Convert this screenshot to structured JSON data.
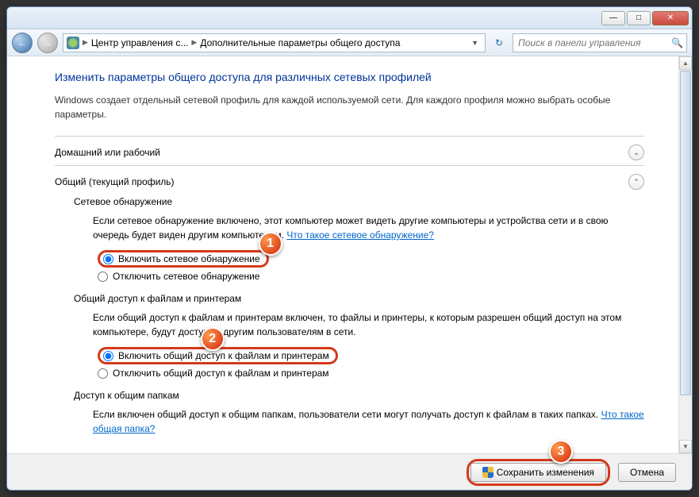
{
  "titlebar": {},
  "navbar": {
    "breadcrumb": {
      "item1": "Центр управления с...",
      "item2": "Дополнительные параметры общего доступа"
    },
    "search_placeholder": "Поиск в панели управления"
  },
  "heading": "Изменить параметры общего доступа для различных сетевых профилей",
  "intro": "Windows создает отдельный сетевой профиль для каждой используемой сети. Для каждого профиля можно выбрать особые параметры.",
  "profiles": {
    "home": {
      "title": "Домашний или рабочий"
    },
    "public": {
      "title": "Общий (текущий профиль)"
    }
  },
  "discovery": {
    "title": "Сетевое обнаружение",
    "text": "Если сетевое обнаружение включено, этот компьютер может видеть другие компьютеры и устройства сети и в свою очередь будет виден другим компьютерам. ",
    "link": "Что такое сетевое обнаружение?",
    "opt_on": "Включить сетевое обнаружение",
    "opt_off": "Отключить сетевое обнаружение"
  },
  "fileshare": {
    "title": "Общий доступ к файлам и принтерам",
    "text": "Если общий доступ к файлам и принтерам включен, то файлы и принтеры, к которым разрешен общий доступ на этом компьютере, будут доступны другим пользователям в сети.",
    "opt_on": "Включить общий доступ к файлам и принтерам",
    "opt_off": "Отключить общий доступ к файлам и принтерам"
  },
  "publicfolders": {
    "title": "Доступ к общим папкам",
    "text": "Если включен общий доступ к общим папкам, пользователи сети могут получать доступ к файлам в таких папках. ",
    "link": "Что такое общая папка?"
  },
  "footer": {
    "save": "Сохранить изменения",
    "cancel": "Отмена"
  },
  "badges": {
    "b1": "1",
    "b2": "2",
    "b3": "3"
  }
}
